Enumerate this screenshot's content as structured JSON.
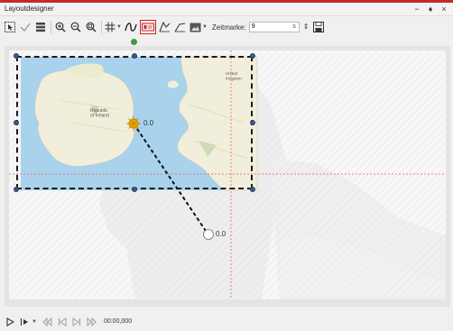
{
  "window": {
    "title": "Layoutdesigner"
  },
  "window_controls": {
    "minimize": "−",
    "pin": "♦",
    "close": "×"
  },
  "toolbar": {
    "zeitmarke_label": "Zeitmarke:",
    "zeitmarke_value": "9",
    "zeitmarke_unit": "s"
  },
  "canvas": {
    "country_label": "Republic\nof Ireland",
    "uk_label": "United\nKingdom",
    "start_marker_label": "0.0",
    "end_marker_label": "0.0"
  },
  "playback": {
    "time": "00:00,000"
  },
  "colors": {
    "accent": "#c52a2a",
    "sea": "#a9d3ec",
    "land": "#f1efdc",
    "handle": "#3b5a8c",
    "rotation_handle": "#3f9a44",
    "guide": "#e05a5a"
  }
}
